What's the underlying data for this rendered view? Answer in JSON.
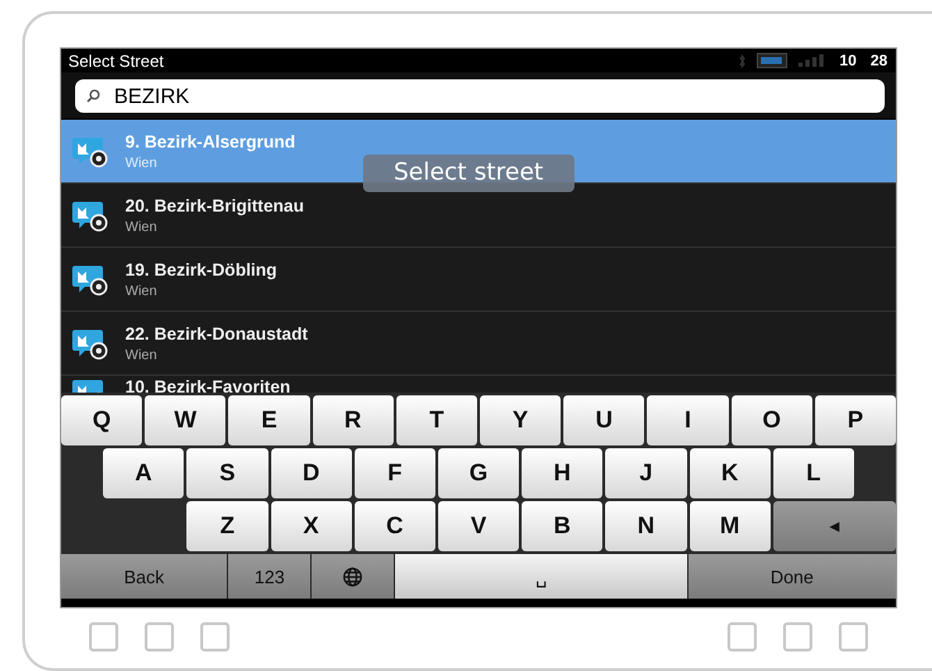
{
  "status_bar": {
    "title": "Select Street",
    "clock_hours": "10",
    "clock_minutes": "28"
  },
  "search": {
    "value": "BEZIRK"
  },
  "results": [
    {
      "name": "9. Bezirk-Alsergrund",
      "city": "Wien",
      "selected": true
    },
    {
      "name": "20. Bezirk-Brigittenau",
      "city": "Wien",
      "selected": false
    },
    {
      "name": "19. Bezirk-Döbling",
      "city": "Wien",
      "selected": false
    },
    {
      "name": "22. Bezirk-Donaustadt",
      "city": "Wien",
      "selected": false
    },
    {
      "name": "10. Bezirk-Favoriten",
      "selected": false
    }
  ],
  "tooltip": "Select street",
  "keyboard": {
    "rows": [
      [
        {
          "kind": "letter",
          "label": "Q"
        },
        {
          "kind": "letter",
          "label": "W"
        },
        {
          "kind": "letter",
          "label": "E"
        },
        {
          "kind": "letter",
          "label": "R"
        },
        {
          "kind": "letter",
          "label": "T"
        },
        {
          "kind": "letter",
          "label": "Y"
        },
        {
          "kind": "letter",
          "label": "U"
        },
        {
          "kind": "letter",
          "label": "I"
        },
        {
          "kind": "letter",
          "label": "O"
        },
        {
          "kind": "letter",
          "label": "P"
        }
      ],
      [
        {
          "kind": "letter",
          "label": "A"
        },
        {
          "kind": "letter",
          "label": "S"
        },
        {
          "kind": "letter",
          "label": "D"
        },
        {
          "kind": "letter",
          "label": "F"
        },
        {
          "kind": "letter",
          "label": "G"
        },
        {
          "kind": "letter",
          "label": "H"
        },
        {
          "kind": "letter",
          "label": "J"
        },
        {
          "kind": "letter",
          "label": "K"
        },
        {
          "kind": "letter",
          "label": "L"
        }
      ],
      [
        {
          "kind": "letter",
          "label": "Z"
        },
        {
          "kind": "letter",
          "label": "X"
        },
        {
          "kind": "letter",
          "label": "C"
        },
        {
          "kind": "letter",
          "label": "V"
        },
        {
          "kind": "letter",
          "label": "B"
        },
        {
          "kind": "letter",
          "label": "N"
        },
        {
          "kind": "letter",
          "label": "M"
        },
        {
          "kind": "backspace",
          "label": "◄"
        }
      ],
      [
        {
          "kind": "back",
          "label": "Back"
        },
        {
          "kind": "numbers",
          "label": "123"
        },
        {
          "kind": "globe"
        },
        {
          "kind": "space",
          "label": "␣"
        },
        {
          "kind": "done",
          "label": "Done"
        }
      ]
    ]
  }
}
